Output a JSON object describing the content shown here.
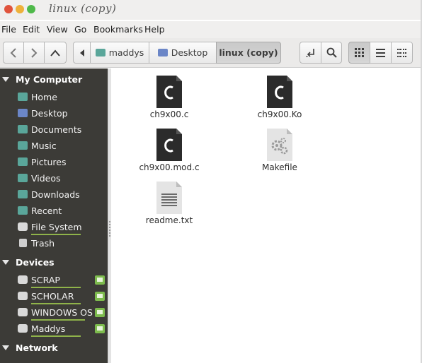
{
  "window": {
    "title": "linux (copy)"
  },
  "menu": [
    "File",
    "Edit",
    "View",
    "Go",
    "Bookmarks",
    "Help"
  ],
  "toolbar": {
    "breadcrumbs": [
      {
        "label": "maddys",
        "icon": "home-folder-icon"
      },
      {
        "label": "Desktop",
        "icon": "desktop-folder-icon"
      },
      {
        "label": "linux (copy)",
        "active": true
      }
    ]
  },
  "sidebar": {
    "sections": [
      {
        "title": "My Computer",
        "items": [
          {
            "label": "Home",
            "icon": "home-folder-icon"
          },
          {
            "label": "Desktop",
            "icon": "desktop-folder-icon"
          },
          {
            "label": "Documents",
            "icon": "documents-folder-icon"
          },
          {
            "label": "Music",
            "icon": "music-folder-icon"
          },
          {
            "label": "Pictures",
            "icon": "pictures-folder-icon"
          },
          {
            "label": "Videos",
            "icon": "videos-folder-icon"
          },
          {
            "label": "Downloads",
            "icon": "downloads-folder-icon"
          },
          {
            "label": "Recent",
            "icon": "recent-folder-icon"
          },
          {
            "label": "File System",
            "icon": "drive-icon",
            "usage": 0.6
          },
          {
            "label": "Trash",
            "icon": "trash-icon"
          }
        ]
      },
      {
        "title": "Devices",
        "items": [
          {
            "label": "SCRAP",
            "icon": "drive-icon",
            "usage": 0.55,
            "ejectable": true
          },
          {
            "label": "SCHOLAR",
            "icon": "drive-icon",
            "usage": 0.6,
            "ejectable": true
          },
          {
            "label": "WINDOWS OS",
            "icon": "drive-icon",
            "usage": 0.5,
            "ejectable": true
          },
          {
            "label": "Maddys",
            "icon": "usb-drive-icon",
            "usage": 0.5,
            "ejectable": true
          }
        ]
      },
      {
        "title": "Network",
        "items": []
      }
    ]
  },
  "files": [
    {
      "name": "ch9x00.c",
      "type": "c-source-icon",
      "glyph": "C"
    },
    {
      "name": "ch9x00.Ko",
      "type": "c-source-icon",
      "glyph": "C"
    },
    {
      "name": "ch9x00.mod.c",
      "type": "c-source-icon",
      "glyph": "C"
    },
    {
      "name": "Makefile",
      "type": "makefile-icon"
    },
    {
      "name": "readme.txt",
      "type": "text-file-icon"
    }
  ],
  "colors": {
    "sidebar_bg": "#3c3b37",
    "accent_green": "#8fb34a",
    "folder_teal": "#5aa69a"
  }
}
